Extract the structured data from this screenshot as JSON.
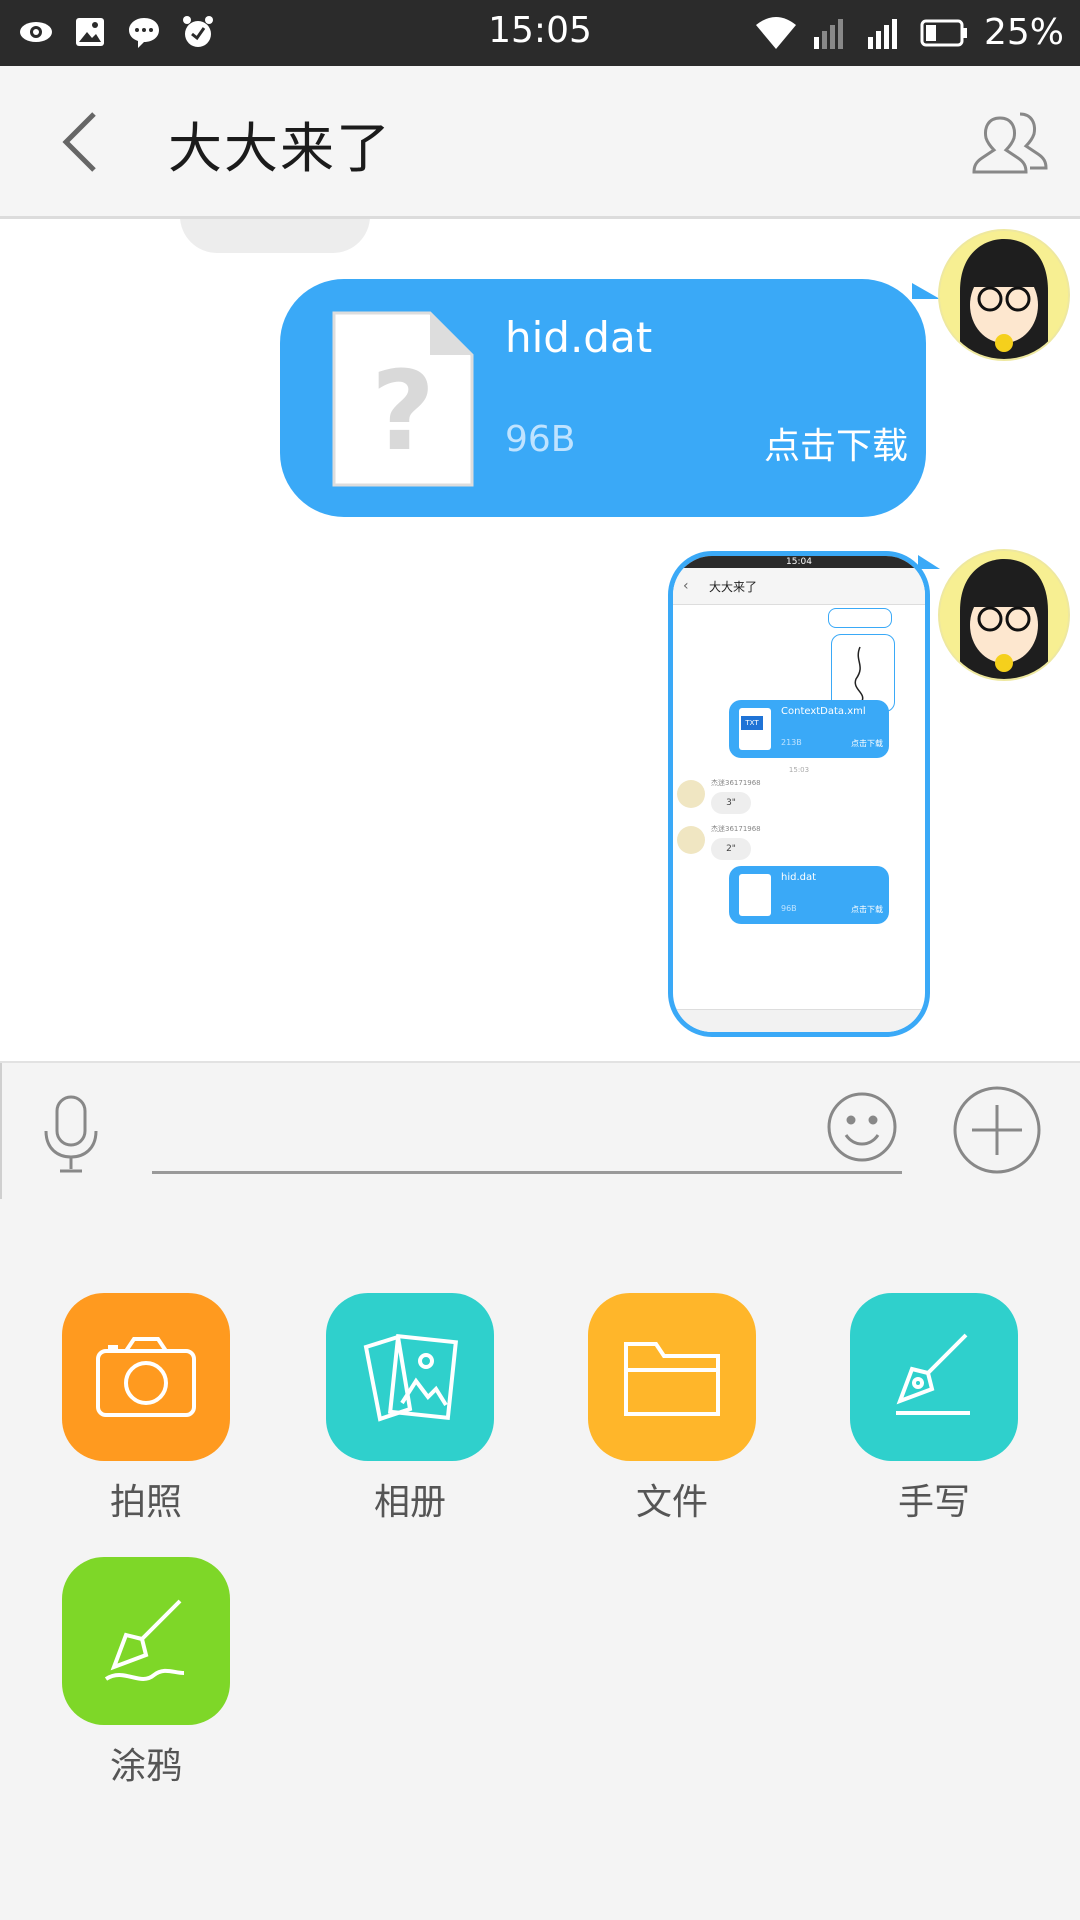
{
  "status_bar": {
    "time": "15:05",
    "battery_text": "25%",
    "left_icons": [
      "eye-icon",
      "image-icon",
      "chat-bubble-icon",
      "alarm-icon"
    ],
    "right_icons": [
      "wifi-icon",
      "signal-icon",
      "signal-icon-2",
      "battery-icon"
    ]
  },
  "header": {
    "title": "大大来了",
    "back_icon": "chevron-left-icon",
    "group_icon": "group-members-icon"
  },
  "messages": [
    {
      "type": "file",
      "file_name": "hid.dat",
      "file_size": "96B",
      "action": "点击下载",
      "bubble_color": "#3aa9f7"
    },
    {
      "type": "image",
      "thumbnail": {
        "time": "15:04",
        "title": "大大来了",
        "files": [
          {
            "name": "ContextData.xml",
            "size": "213B",
            "action": "点击下载",
            "icon_label": "TXT"
          },
          {
            "name": "hid.dat",
            "size": "96B",
            "action": "点击下载"
          }
        ],
        "timestamp": "15:03",
        "voice_messages": [
          {
            "sender": "杰迷36171968",
            "duration": "3\""
          },
          {
            "sender": "杰迷36171968",
            "duration": "2\""
          }
        ]
      }
    }
  ],
  "input_bar": {
    "mic_icon": "microphone-icon",
    "input_value": "",
    "emoji_icon": "smiley-icon",
    "plus_icon": "plus-circle-icon"
  },
  "panel": {
    "items": [
      {
        "label": "拍照",
        "icon": "camera-icon",
        "color": "#ff9a1f"
      },
      {
        "label": "相册",
        "icon": "photo-album-icon",
        "color": "#2fd0cc"
      },
      {
        "label": "文件",
        "icon": "folder-icon",
        "color": "#ffb62a"
      },
      {
        "label": "手写",
        "icon": "pen-nib-icon",
        "color": "#2fd0cc"
      },
      {
        "label": "涂鸦",
        "icon": "brush-icon",
        "color": "#7ed728"
      }
    ]
  }
}
